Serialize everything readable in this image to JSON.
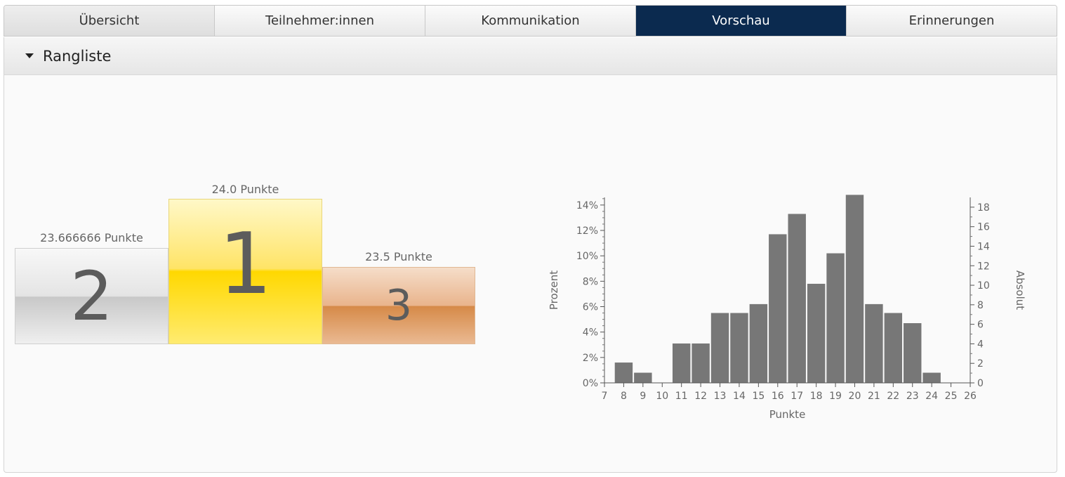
{
  "tabs": [
    {
      "label": "Übersicht"
    },
    {
      "label": "Teilnehmer:innen"
    },
    {
      "label": "Kommunikation"
    },
    {
      "label": "Vorschau"
    },
    {
      "label": "Erinnerungen"
    }
  ],
  "active_tab": "Vorschau",
  "section": {
    "title": "Rangliste"
  },
  "podium": {
    "first": {
      "rank": "1",
      "label": "24.0 Punkte"
    },
    "second": {
      "rank": "2",
      "label": "23.666666 Punkte"
    },
    "third": {
      "rank": "3",
      "label": "23.5 Punkte"
    }
  },
  "colors": {
    "accent": "#0b2a4f",
    "bars": "#777777",
    "gold": "#ffd800",
    "silver": "#c8c8c8",
    "bronze": "#d68a48"
  },
  "chart_data": {
    "type": "bar",
    "xlabel": "Punkte",
    "ylabel": "Prozent",
    "y2label": "Absolut",
    "x_ticks": [
      7,
      8,
      9,
      10,
      11,
      12,
      13,
      14,
      15,
      16,
      17,
      18,
      19,
      20,
      21,
      22,
      23,
      24,
      25,
      26
    ],
    "y_ticks": [
      "0%",
      "2%",
      "4%",
      "6%",
      "8%",
      "10%",
      "12%",
      "14%"
    ],
    "y2_ticks": [
      "0",
      "2",
      "4",
      "6",
      "8",
      "10",
      "12",
      "14",
      "16",
      "18"
    ],
    "xlim": [
      7,
      26
    ],
    "ylim": [
      0,
      14.6
    ],
    "y2lim": [
      0,
      19
    ],
    "bars": [
      {
        "x": 8,
        "percent": 1.6
      },
      {
        "x": 9,
        "percent": 0.8
      },
      {
        "x": 10,
        "percent": 0
      },
      {
        "x": 11,
        "percent": 3.1
      },
      {
        "x": 12,
        "percent": 3.1
      },
      {
        "x": 13,
        "percent": 5.5
      },
      {
        "x": 14,
        "percent": 5.5
      },
      {
        "x": 15,
        "percent": 6.2
      },
      {
        "x": 16,
        "percent": 11.7
      },
      {
        "x": 17,
        "percent": 13.3
      },
      {
        "x": 18,
        "percent": 7.8
      },
      {
        "x": 19,
        "percent": 10.2
      },
      {
        "x": 20,
        "percent": 14.8
      },
      {
        "x": 21,
        "percent": 6.2
      },
      {
        "x": 22,
        "percent": 5.5
      },
      {
        "x": 23,
        "percent": 4.7
      },
      {
        "x": 24,
        "percent": 0.8
      }
    ]
  }
}
